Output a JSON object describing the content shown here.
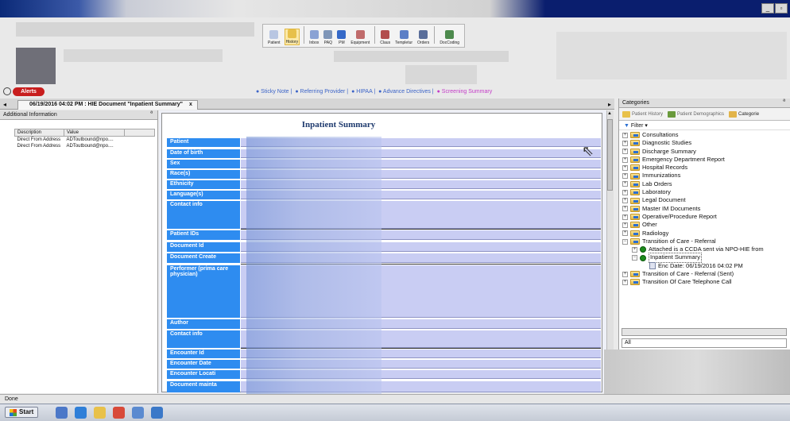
{
  "toolbar": {
    "items": [
      {
        "label": "Patient",
        "color": "#b8c6e2"
      },
      {
        "label": "History",
        "color": "#e7c04a",
        "selected": true
      },
      {
        "label": "Inbox",
        "color": "#8aa2d4"
      },
      {
        "label": "PAQ",
        "color": "#7f96b8"
      },
      {
        "label": "PM",
        "color": "#3569c8"
      },
      {
        "label": "Equipment",
        "color": "#c06b6b"
      },
      {
        "label": "Claus",
        "color": "#b24d4d"
      },
      {
        "label": "Templetur",
        "color": "#5c7fc6"
      },
      {
        "label": "Orders",
        "color": "#5a6e9a"
      },
      {
        "label": "DocCoding",
        "color": "#4d8a4d"
      }
    ]
  },
  "alerts_label": "Alerts",
  "quicklinks": [
    "Sticky Note",
    "Referring Provider",
    "HIPAA",
    "Advance Directives",
    "Screening Summary"
  ],
  "doc_tab": {
    "label": "06/19/2016 04:02 PM : HIE Document \"Inpatient Summary\"",
    "close": "x"
  },
  "left_pane": {
    "title": "Additional Information",
    "columns": [
      "Description",
      "Value"
    ],
    "rows": [
      [
        "Direct From Address",
        "ADToutbound@npo...."
      ],
      [
        "Direct From Address",
        "ADToutbound@npo...."
      ]
    ]
  },
  "document": {
    "title": "Inpatient Summary",
    "labels": [
      "Patient",
      "Date of birth",
      "Sex",
      "Race(s)",
      "Ethnicity",
      "Language(s)",
      "Contact info",
      "Patient IDs",
      "Document Id",
      "Document Create",
      "Performer (prima care physician)",
      "Author",
      "Contact info",
      "Encounter Id",
      "Encounter Date",
      "Encounter Locati",
      "Document mainta"
    ]
  },
  "right_pane": {
    "title": "Categories",
    "tabs": [
      "Patient History",
      "Patient Demographics",
      "Categorie"
    ],
    "filter_label": "Filter",
    "tree": [
      {
        "label": "Consultations",
        "level": 0,
        "type": "folder"
      },
      {
        "label": "Diagnostic Studies",
        "level": 0,
        "type": "folder"
      },
      {
        "label": "Discharge Summary",
        "level": 0,
        "type": "folder"
      },
      {
        "label": "Emergency Department Report",
        "level": 0,
        "type": "folder"
      },
      {
        "label": "Hospital Records",
        "level": 0,
        "type": "folder"
      },
      {
        "label": "Immunizations",
        "level": 0,
        "type": "folder"
      },
      {
        "label": "Lab Orders",
        "level": 0,
        "type": "folder"
      },
      {
        "label": "Laboratory",
        "level": 0,
        "type": "folder"
      },
      {
        "label": "Legal Document",
        "level": 0,
        "type": "folder"
      },
      {
        "label": "Master IM Documents",
        "level": 0,
        "type": "folder"
      },
      {
        "label": "Operative/Procedure Report",
        "level": 0,
        "type": "folder"
      },
      {
        "label": "Other",
        "level": 0,
        "type": "folder"
      },
      {
        "label": "Radiology",
        "level": 0,
        "type": "folder"
      },
      {
        "label": "Transition of Care - Referral",
        "level": 0,
        "type": "folder",
        "expanded": true
      },
      {
        "label": "Attached is a CCDA sent via NPO-HIE from",
        "level": 1,
        "type": "bullet"
      },
      {
        "label": "Inpatient Summary",
        "level": 1,
        "type": "bullet",
        "expanded": true,
        "selected": true
      },
      {
        "label": "Enc Date: 06/19/2016 04:02 PM",
        "level": 2,
        "type": "doc"
      },
      {
        "label": "Transition of Care - Referral (Sent)",
        "level": 0,
        "type": "folder"
      },
      {
        "label": "Transition Of Care Telephone Call",
        "level": 0,
        "type": "folder"
      }
    ],
    "combo_value": "All"
  },
  "status_text": "Done",
  "taskbar": {
    "start_label": "Start",
    "apps": [
      "#4c78c8",
      "#2f7fd8",
      "#e8c14a",
      "#d84a3a",
      "#5a8ad0",
      "#3a78c8"
    ]
  }
}
